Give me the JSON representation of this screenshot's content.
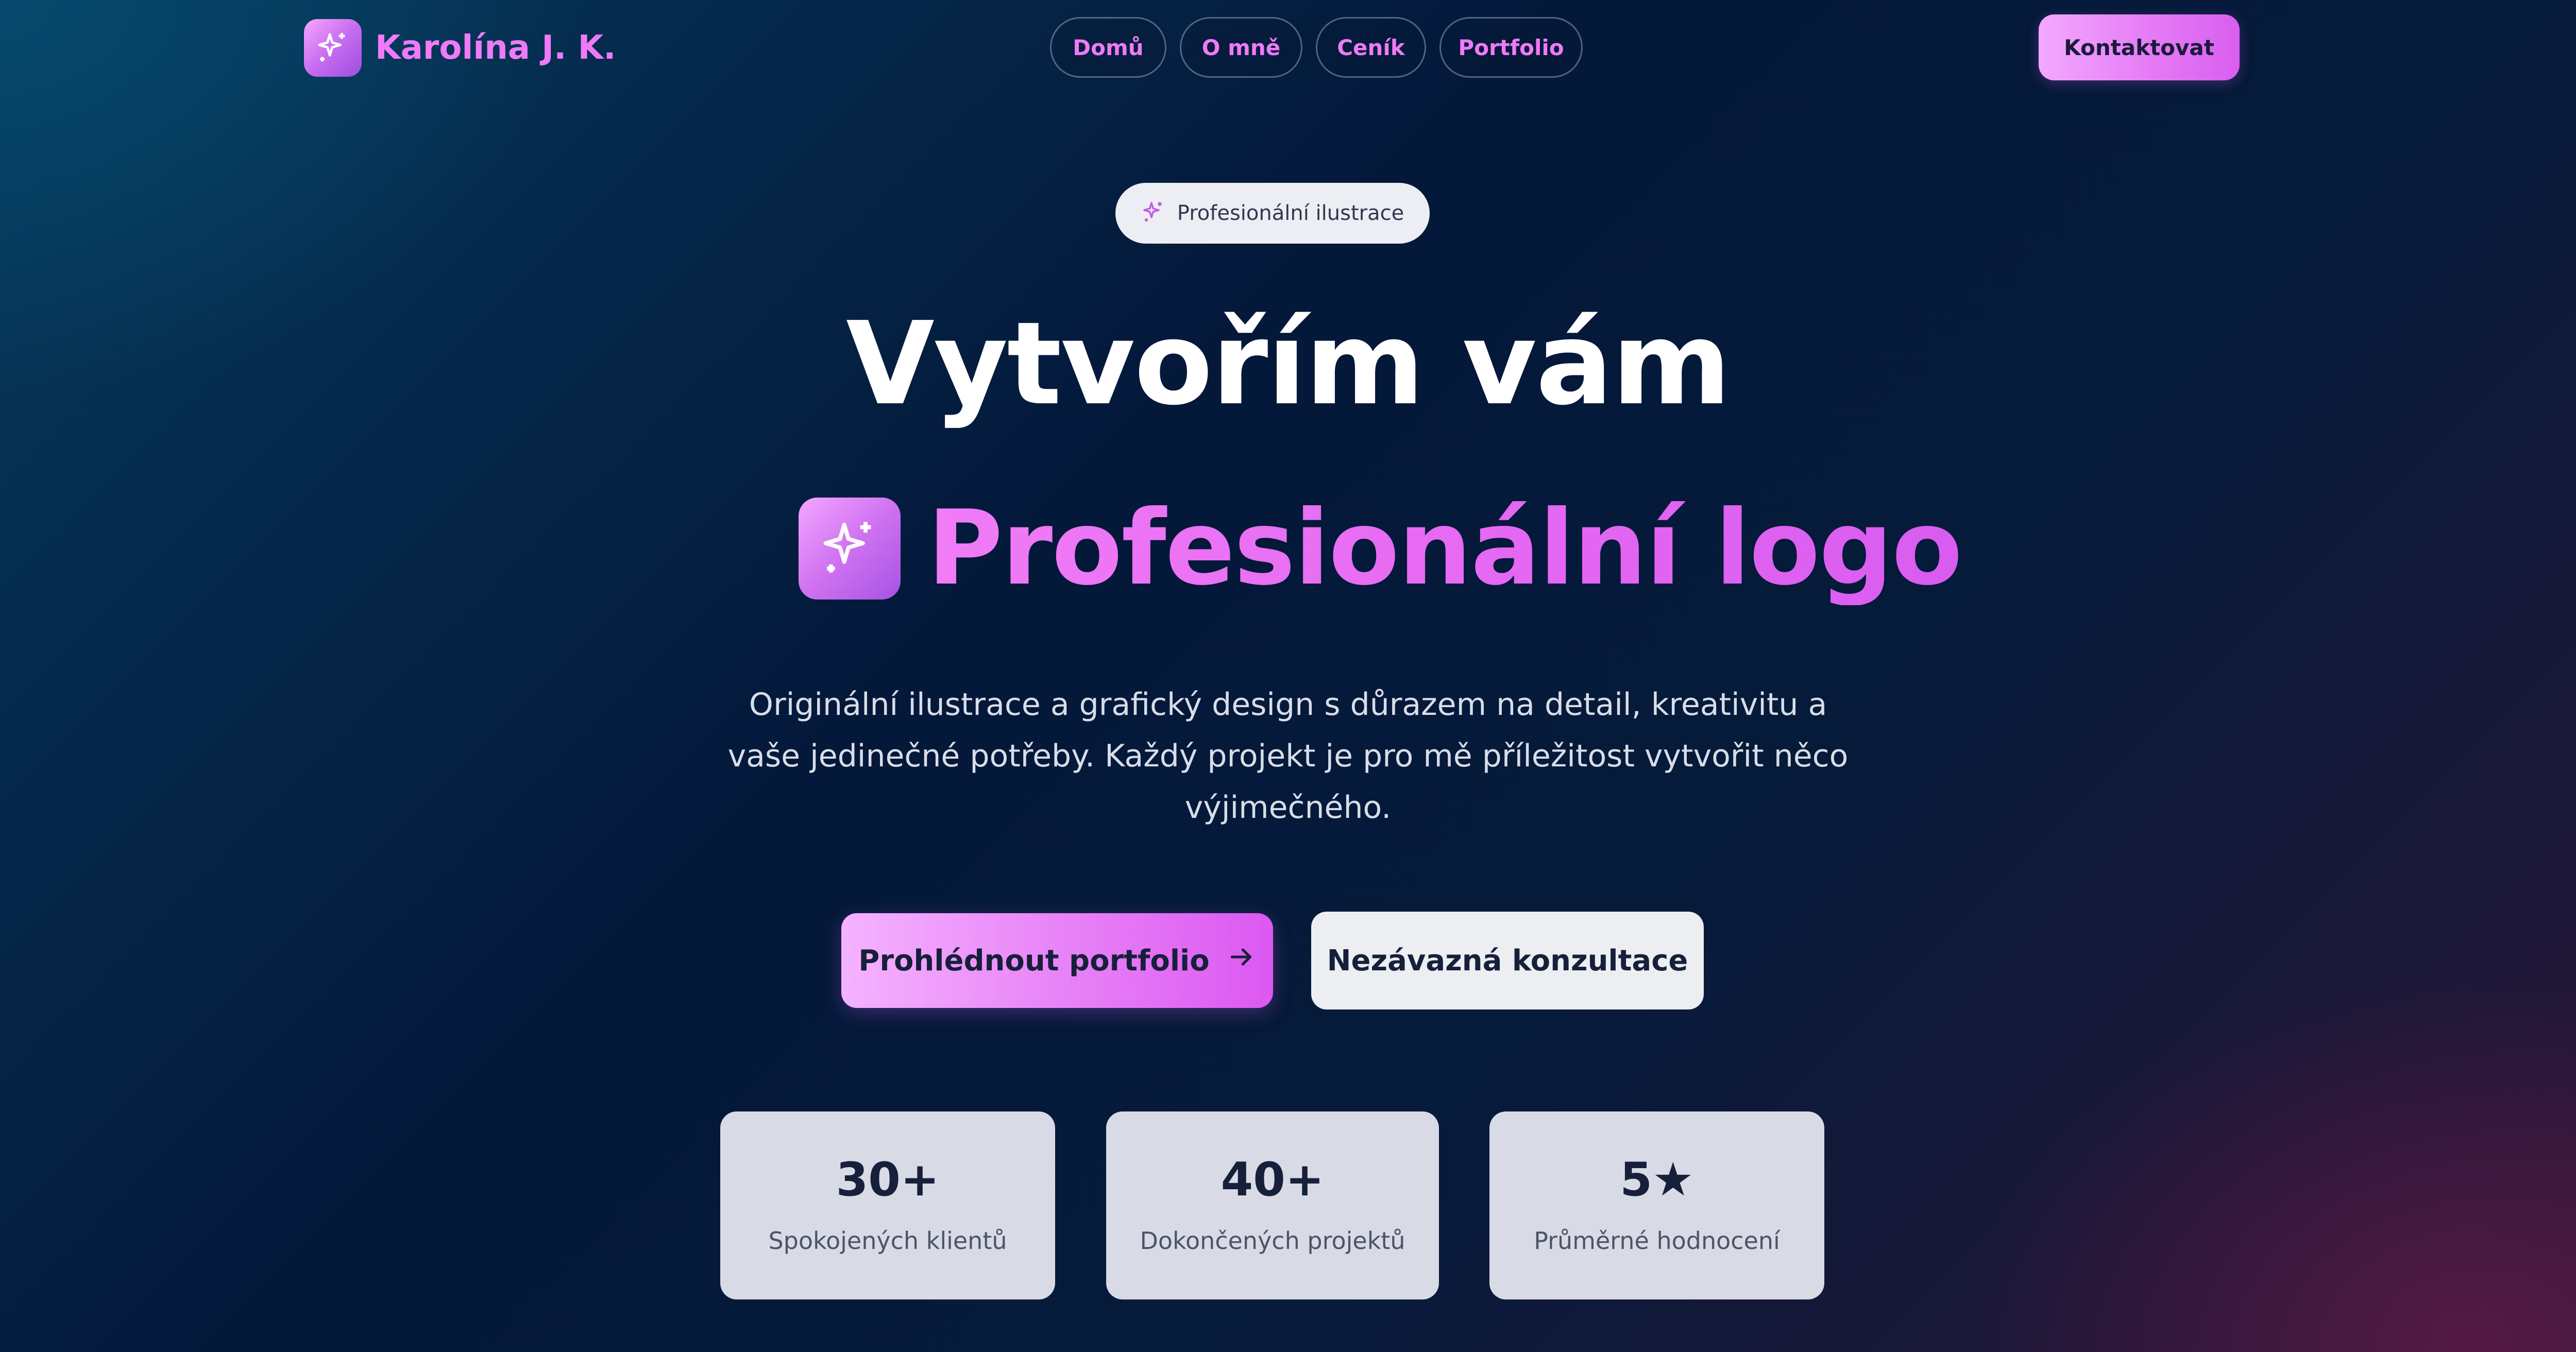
{
  "header": {
    "brand_name": "Karolína J. K.",
    "brand_icon": "sparkles-icon",
    "nav": [
      {
        "label": "Domů"
      },
      {
        "label": "O mně"
      },
      {
        "label": "Ceník"
      },
      {
        "label": "Portfolio"
      }
    ],
    "contact_label": "Kontaktovat"
  },
  "hero": {
    "pill_label": "Profesionální ilustrace",
    "pill_icon": "sparkles-icon",
    "headline_line1": "Vytvořím vám",
    "headline_line2": "Profesionální logo",
    "headline_icon": "sparkles-icon",
    "description": "Originální ilustrace a grafický design s důrazem na detail, kreativitu a vaše jedinečné potřeby. Každý projekt je pro mě příležitost vytvořit něco výjimečného.",
    "cta_primary": "Prohlédnout portfolio",
    "cta_primary_icon": "arrow-right-icon",
    "cta_secondary": "Nezávazná konzultace"
  },
  "stats": [
    {
      "value": "30+",
      "label": "Spokojených klientů"
    },
    {
      "value": "40+",
      "label": "Dokončených projektů"
    },
    {
      "value": "5★",
      "label": "Průměrné hodnocení"
    }
  ],
  "colors": {
    "accent": "#ef7af7",
    "accent_dark": "#d95ef0",
    "background_dark": "#04183a",
    "text_dark": "#16203a",
    "card_bg": "#e8eaf2"
  }
}
